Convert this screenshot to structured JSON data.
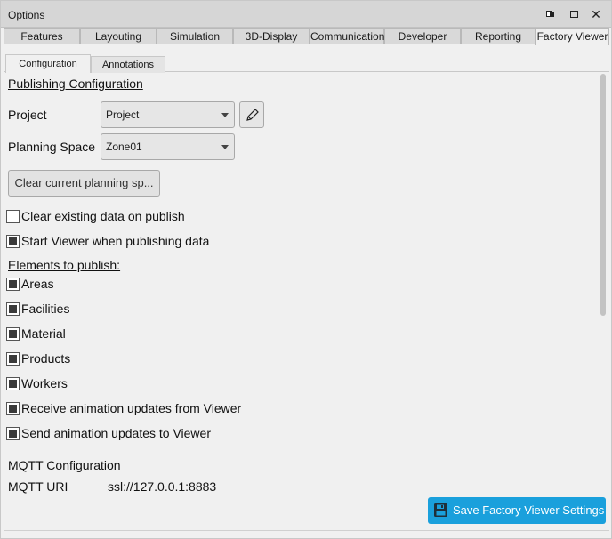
{
  "window": {
    "title": "Options",
    "controls": [
      "float-icon",
      "maximize-icon",
      "close-icon"
    ]
  },
  "tabs": [
    {
      "label": "Features",
      "active": false
    },
    {
      "label": "Layouting",
      "active": false
    },
    {
      "label": "Simulation",
      "active": false
    },
    {
      "label": "3D-Display",
      "active": false
    },
    {
      "label": "Communication",
      "active": false
    },
    {
      "label": "Developer",
      "active": false
    },
    {
      "label": "Reporting",
      "active": false
    },
    {
      "label": "Factory Viewer",
      "active": true
    }
  ],
  "subtabs": [
    {
      "label": "Configuration",
      "active": true
    },
    {
      "label": "Annotations",
      "active": false
    }
  ],
  "publishing": {
    "heading": "Publishing Configuration",
    "project_label": "Project",
    "project_value": "Project",
    "edit_icon": "pencil-icon",
    "planning_space_label": "Planning Space",
    "planning_space_value": "Zone01",
    "clear_button": "Clear current planning sp...",
    "clear_existing": {
      "label": "Clear existing data on publish",
      "checked": false
    },
    "start_viewer": {
      "label": "Start Viewer when publishing data",
      "checked": true
    }
  },
  "elements": {
    "heading": "Elements to publish:",
    "items": [
      {
        "label": "Areas",
        "checked": true
      },
      {
        "label": "Facilities",
        "checked": true
      },
      {
        "label": "Material",
        "checked": true
      },
      {
        "label": "Products",
        "checked": true
      },
      {
        "label": "Workers",
        "checked": true
      },
      {
        "label": "Receive animation updates from Viewer",
        "checked": true
      },
      {
        "label": "Send animation updates to Viewer",
        "checked": true
      }
    ]
  },
  "mqtt": {
    "heading": "MQTT Configuration",
    "uri_label": "MQTT URI",
    "uri_value": "ssl://127.0.0.1:8883"
  },
  "save_button": {
    "label": "Save Factory Viewer Settings",
    "icon": "save-icon",
    "color": "#1aa0dc"
  }
}
